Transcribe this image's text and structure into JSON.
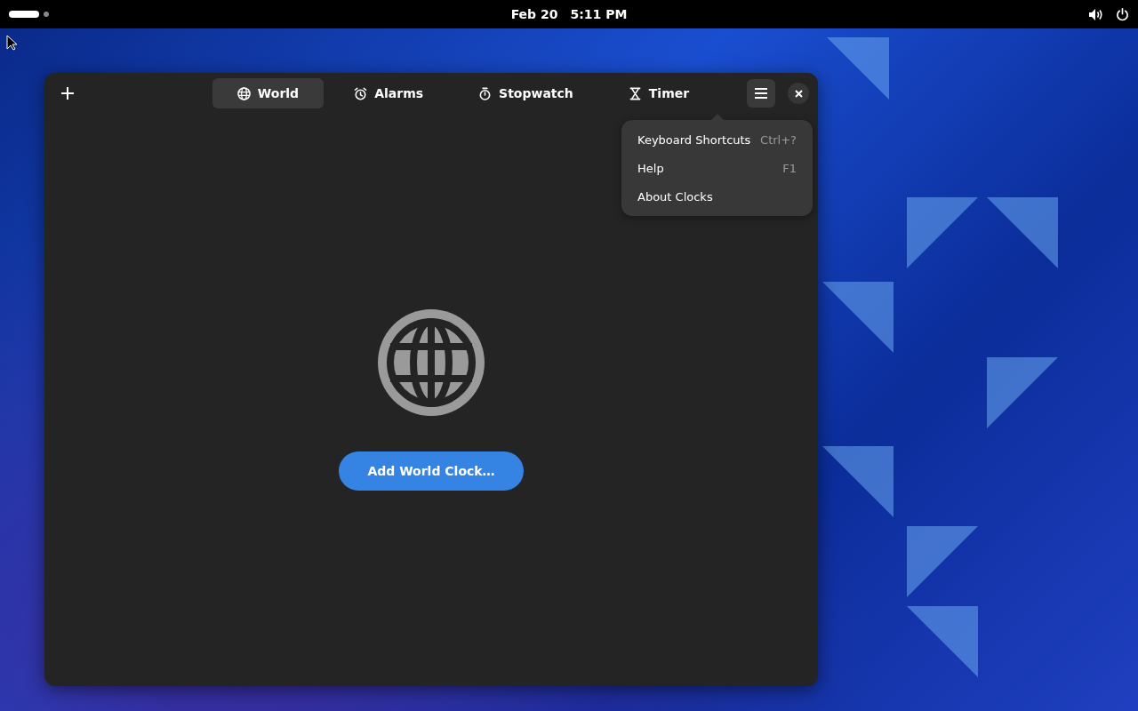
{
  "top_bar": {
    "date": "Feb 20",
    "time": "5:11 PM"
  },
  "window": {
    "tabs": [
      {
        "label": "World",
        "kind": "world",
        "selected": true
      },
      {
        "label": "Alarms",
        "kind": "alarms",
        "selected": false
      },
      {
        "label": "Stopwatch",
        "kind": "stopwatch",
        "selected": false
      },
      {
        "label": "Timer",
        "kind": "timer",
        "selected": false
      }
    ],
    "menu_button": {
      "expanded": true
    },
    "empty_state": {
      "button": "Add World Clock…"
    }
  },
  "menu": {
    "items": [
      {
        "label": "Keyboard Shortcuts",
        "shortcut": "Ctrl+?"
      },
      {
        "label": "Help",
        "shortcut": "F1"
      },
      {
        "label": "About Clocks"
      }
    ]
  }
}
